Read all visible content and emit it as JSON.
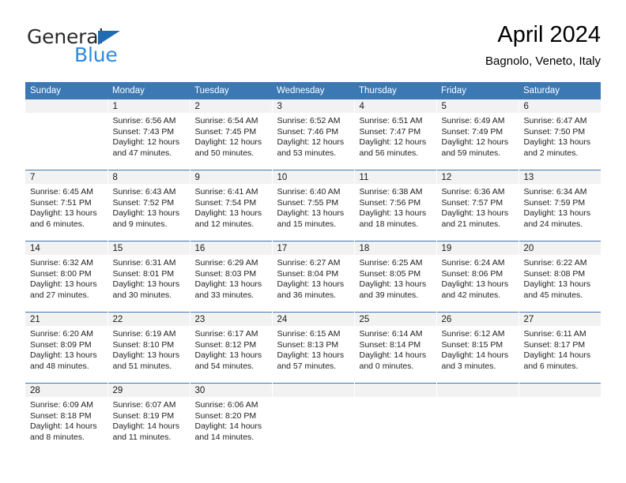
{
  "brand": {
    "name_part1": "General",
    "name_part2": "Blue",
    "triangle_color": "#1f6cb4",
    "blue_color": "#2b8ae0"
  },
  "header": {
    "title": "April 2024",
    "subtitle": "Bagnolo, Veneto, Italy"
  },
  "theme": {
    "header_blue": "#3b78b4",
    "daynum_band": "#f2f2f2"
  },
  "weekdays": [
    "Sunday",
    "Monday",
    "Tuesday",
    "Wednesday",
    "Thursday",
    "Friday",
    "Saturday"
  ],
  "weeks": [
    [
      {
        "day": ""
      },
      {
        "day": "1",
        "sunrise": "Sunrise: 6:56 AM",
        "sunset": "Sunset: 7:43 PM",
        "daylight1": "Daylight: 12 hours",
        "daylight2": "and 47 minutes."
      },
      {
        "day": "2",
        "sunrise": "Sunrise: 6:54 AM",
        "sunset": "Sunset: 7:45 PM",
        "daylight1": "Daylight: 12 hours",
        "daylight2": "and 50 minutes."
      },
      {
        "day": "3",
        "sunrise": "Sunrise: 6:52 AM",
        "sunset": "Sunset: 7:46 PM",
        "daylight1": "Daylight: 12 hours",
        "daylight2": "and 53 minutes."
      },
      {
        "day": "4",
        "sunrise": "Sunrise: 6:51 AM",
        "sunset": "Sunset: 7:47 PM",
        "daylight1": "Daylight: 12 hours",
        "daylight2": "and 56 minutes."
      },
      {
        "day": "5",
        "sunrise": "Sunrise: 6:49 AM",
        "sunset": "Sunset: 7:49 PM",
        "daylight1": "Daylight: 12 hours",
        "daylight2": "and 59 minutes."
      },
      {
        "day": "6",
        "sunrise": "Sunrise: 6:47 AM",
        "sunset": "Sunset: 7:50 PM",
        "daylight1": "Daylight: 13 hours",
        "daylight2": "and 2 minutes."
      }
    ],
    [
      {
        "day": "7",
        "sunrise": "Sunrise: 6:45 AM",
        "sunset": "Sunset: 7:51 PM",
        "daylight1": "Daylight: 13 hours",
        "daylight2": "and 6 minutes."
      },
      {
        "day": "8",
        "sunrise": "Sunrise: 6:43 AM",
        "sunset": "Sunset: 7:52 PM",
        "daylight1": "Daylight: 13 hours",
        "daylight2": "and 9 minutes."
      },
      {
        "day": "9",
        "sunrise": "Sunrise: 6:41 AM",
        "sunset": "Sunset: 7:54 PM",
        "daylight1": "Daylight: 13 hours",
        "daylight2": "and 12 minutes."
      },
      {
        "day": "10",
        "sunrise": "Sunrise: 6:40 AM",
        "sunset": "Sunset: 7:55 PM",
        "daylight1": "Daylight: 13 hours",
        "daylight2": "and 15 minutes."
      },
      {
        "day": "11",
        "sunrise": "Sunrise: 6:38 AM",
        "sunset": "Sunset: 7:56 PM",
        "daylight1": "Daylight: 13 hours",
        "daylight2": "and 18 minutes."
      },
      {
        "day": "12",
        "sunrise": "Sunrise: 6:36 AM",
        "sunset": "Sunset: 7:57 PM",
        "daylight1": "Daylight: 13 hours",
        "daylight2": "and 21 minutes."
      },
      {
        "day": "13",
        "sunrise": "Sunrise: 6:34 AM",
        "sunset": "Sunset: 7:59 PM",
        "daylight1": "Daylight: 13 hours",
        "daylight2": "and 24 minutes."
      }
    ],
    [
      {
        "day": "14",
        "sunrise": "Sunrise: 6:32 AM",
        "sunset": "Sunset: 8:00 PM",
        "daylight1": "Daylight: 13 hours",
        "daylight2": "and 27 minutes."
      },
      {
        "day": "15",
        "sunrise": "Sunrise: 6:31 AM",
        "sunset": "Sunset: 8:01 PM",
        "daylight1": "Daylight: 13 hours",
        "daylight2": "and 30 minutes."
      },
      {
        "day": "16",
        "sunrise": "Sunrise: 6:29 AM",
        "sunset": "Sunset: 8:03 PM",
        "daylight1": "Daylight: 13 hours",
        "daylight2": "and 33 minutes."
      },
      {
        "day": "17",
        "sunrise": "Sunrise: 6:27 AM",
        "sunset": "Sunset: 8:04 PM",
        "daylight1": "Daylight: 13 hours",
        "daylight2": "and 36 minutes."
      },
      {
        "day": "18",
        "sunrise": "Sunrise: 6:25 AM",
        "sunset": "Sunset: 8:05 PM",
        "daylight1": "Daylight: 13 hours",
        "daylight2": "and 39 minutes."
      },
      {
        "day": "19",
        "sunrise": "Sunrise: 6:24 AM",
        "sunset": "Sunset: 8:06 PM",
        "daylight1": "Daylight: 13 hours",
        "daylight2": "and 42 minutes."
      },
      {
        "day": "20",
        "sunrise": "Sunrise: 6:22 AM",
        "sunset": "Sunset: 8:08 PM",
        "daylight1": "Daylight: 13 hours",
        "daylight2": "and 45 minutes."
      }
    ],
    [
      {
        "day": "21",
        "sunrise": "Sunrise: 6:20 AM",
        "sunset": "Sunset: 8:09 PM",
        "daylight1": "Daylight: 13 hours",
        "daylight2": "and 48 minutes."
      },
      {
        "day": "22",
        "sunrise": "Sunrise: 6:19 AM",
        "sunset": "Sunset: 8:10 PM",
        "daylight1": "Daylight: 13 hours",
        "daylight2": "and 51 minutes."
      },
      {
        "day": "23",
        "sunrise": "Sunrise: 6:17 AM",
        "sunset": "Sunset: 8:12 PM",
        "daylight1": "Daylight: 13 hours",
        "daylight2": "and 54 minutes."
      },
      {
        "day": "24",
        "sunrise": "Sunrise: 6:15 AM",
        "sunset": "Sunset: 8:13 PM",
        "daylight1": "Daylight: 13 hours",
        "daylight2": "and 57 minutes."
      },
      {
        "day": "25",
        "sunrise": "Sunrise: 6:14 AM",
        "sunset": "Sunset: 8:14 PM",
        "daylight1": "Daylight: 14 hours",
        "daylight2": "and 0 minutes."
      },
      {
        "day": "26",
        "sunrise": "Sunrise: 6:12 AM",
        "sunset": "Sunset: 8:15 PM",
        "daylight1": "Daylight: 14 hours",
        "daylight2": "and 3 minutes."
      },
      {
        "day": "27",
        "sunrise": "Sunrise: 6:11 AM",
        "sunset": "Sunset: 8:17 PM",
        "daylight1": "Daylight: 14 hours",
        "daylight2": "and 6 minutes."
      }
    ],
    [
      {
        "day": "28",
        "sunrise": "Sunrise: 6:09 AM",
        "sunset": "Sunset: 8:18 PM",
        "daylight1": "Daylight: 14 hours",
        "daylight2": "and 8 minutes."
      },
      {
        "day": "29",
        "sunrise": "Sunrise: 6:07 AM",
        "sunset": "Sunset: 8:19 PM",
        "daylight1": "Daylight: 14 hours",
        "daylight2": "and 11 minutes."
      },
      {
        "day": "30",
        "sunrise": "Sunrise: 6:06 AM",
        "sunset": "Sunset: 8:20 PM",
        "daylight1": "Daylight: 14 hours",
        "daylight2": "and 14 minutes."
      },
      {
        "day": ""
      },
      {
        "day": ""
      },
      {
        "day": ""
      },
      {
        "day": ""
      }
    ]
  ]
}
